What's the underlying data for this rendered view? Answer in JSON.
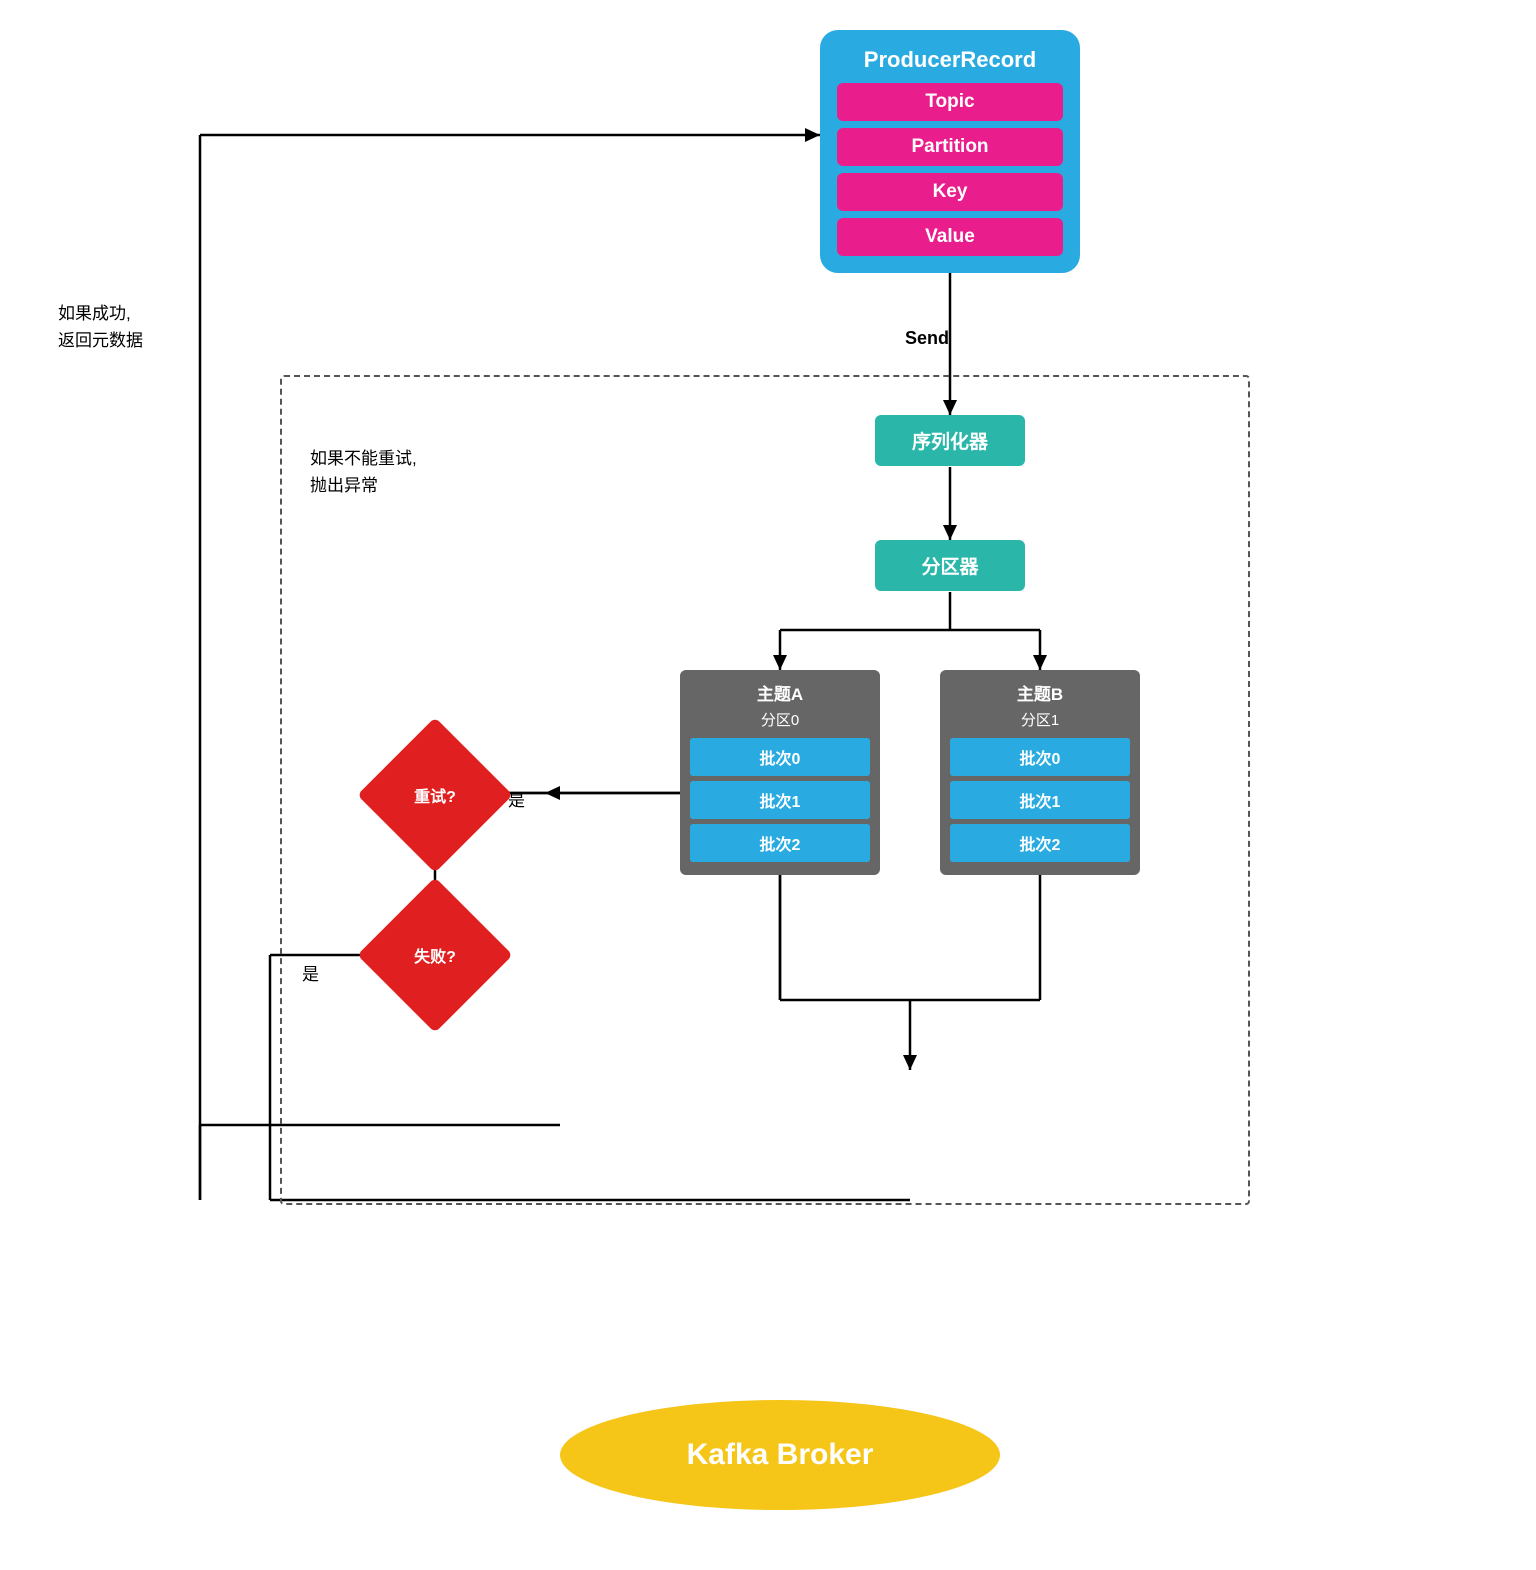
{
  "producer_record": {
    "title": "ProducerRecord",
    "fields": [
      "Topic",
      "Partition",
      "Key",
      "Value"
    ]
  },
  "send_label": "Send",
  "serializer": "序列化器",
  "partitioner": "分区器",
  "topic_a": {
    "header": "主题A",
    "sub": "分区0",
    "batches": [
      "批次0",
      "批次1",
      "批次2"
    ]
  },
  "topic_b": {
    "header": "主题B",
    "sub": "分区1",
    "batches": [
      "批次0",
      "批次1",
      "批次2"
    ]
  },
  "retry_label": "重试?",
  "fail_label": "失败?",
  "yes_label": "是",
  "success_label": "如果成功,\n返回元数据",
  "retry_error_label": "如果不能重试,\n抛出异常",
  "kafka_broker": "Kafka Broker"
}
